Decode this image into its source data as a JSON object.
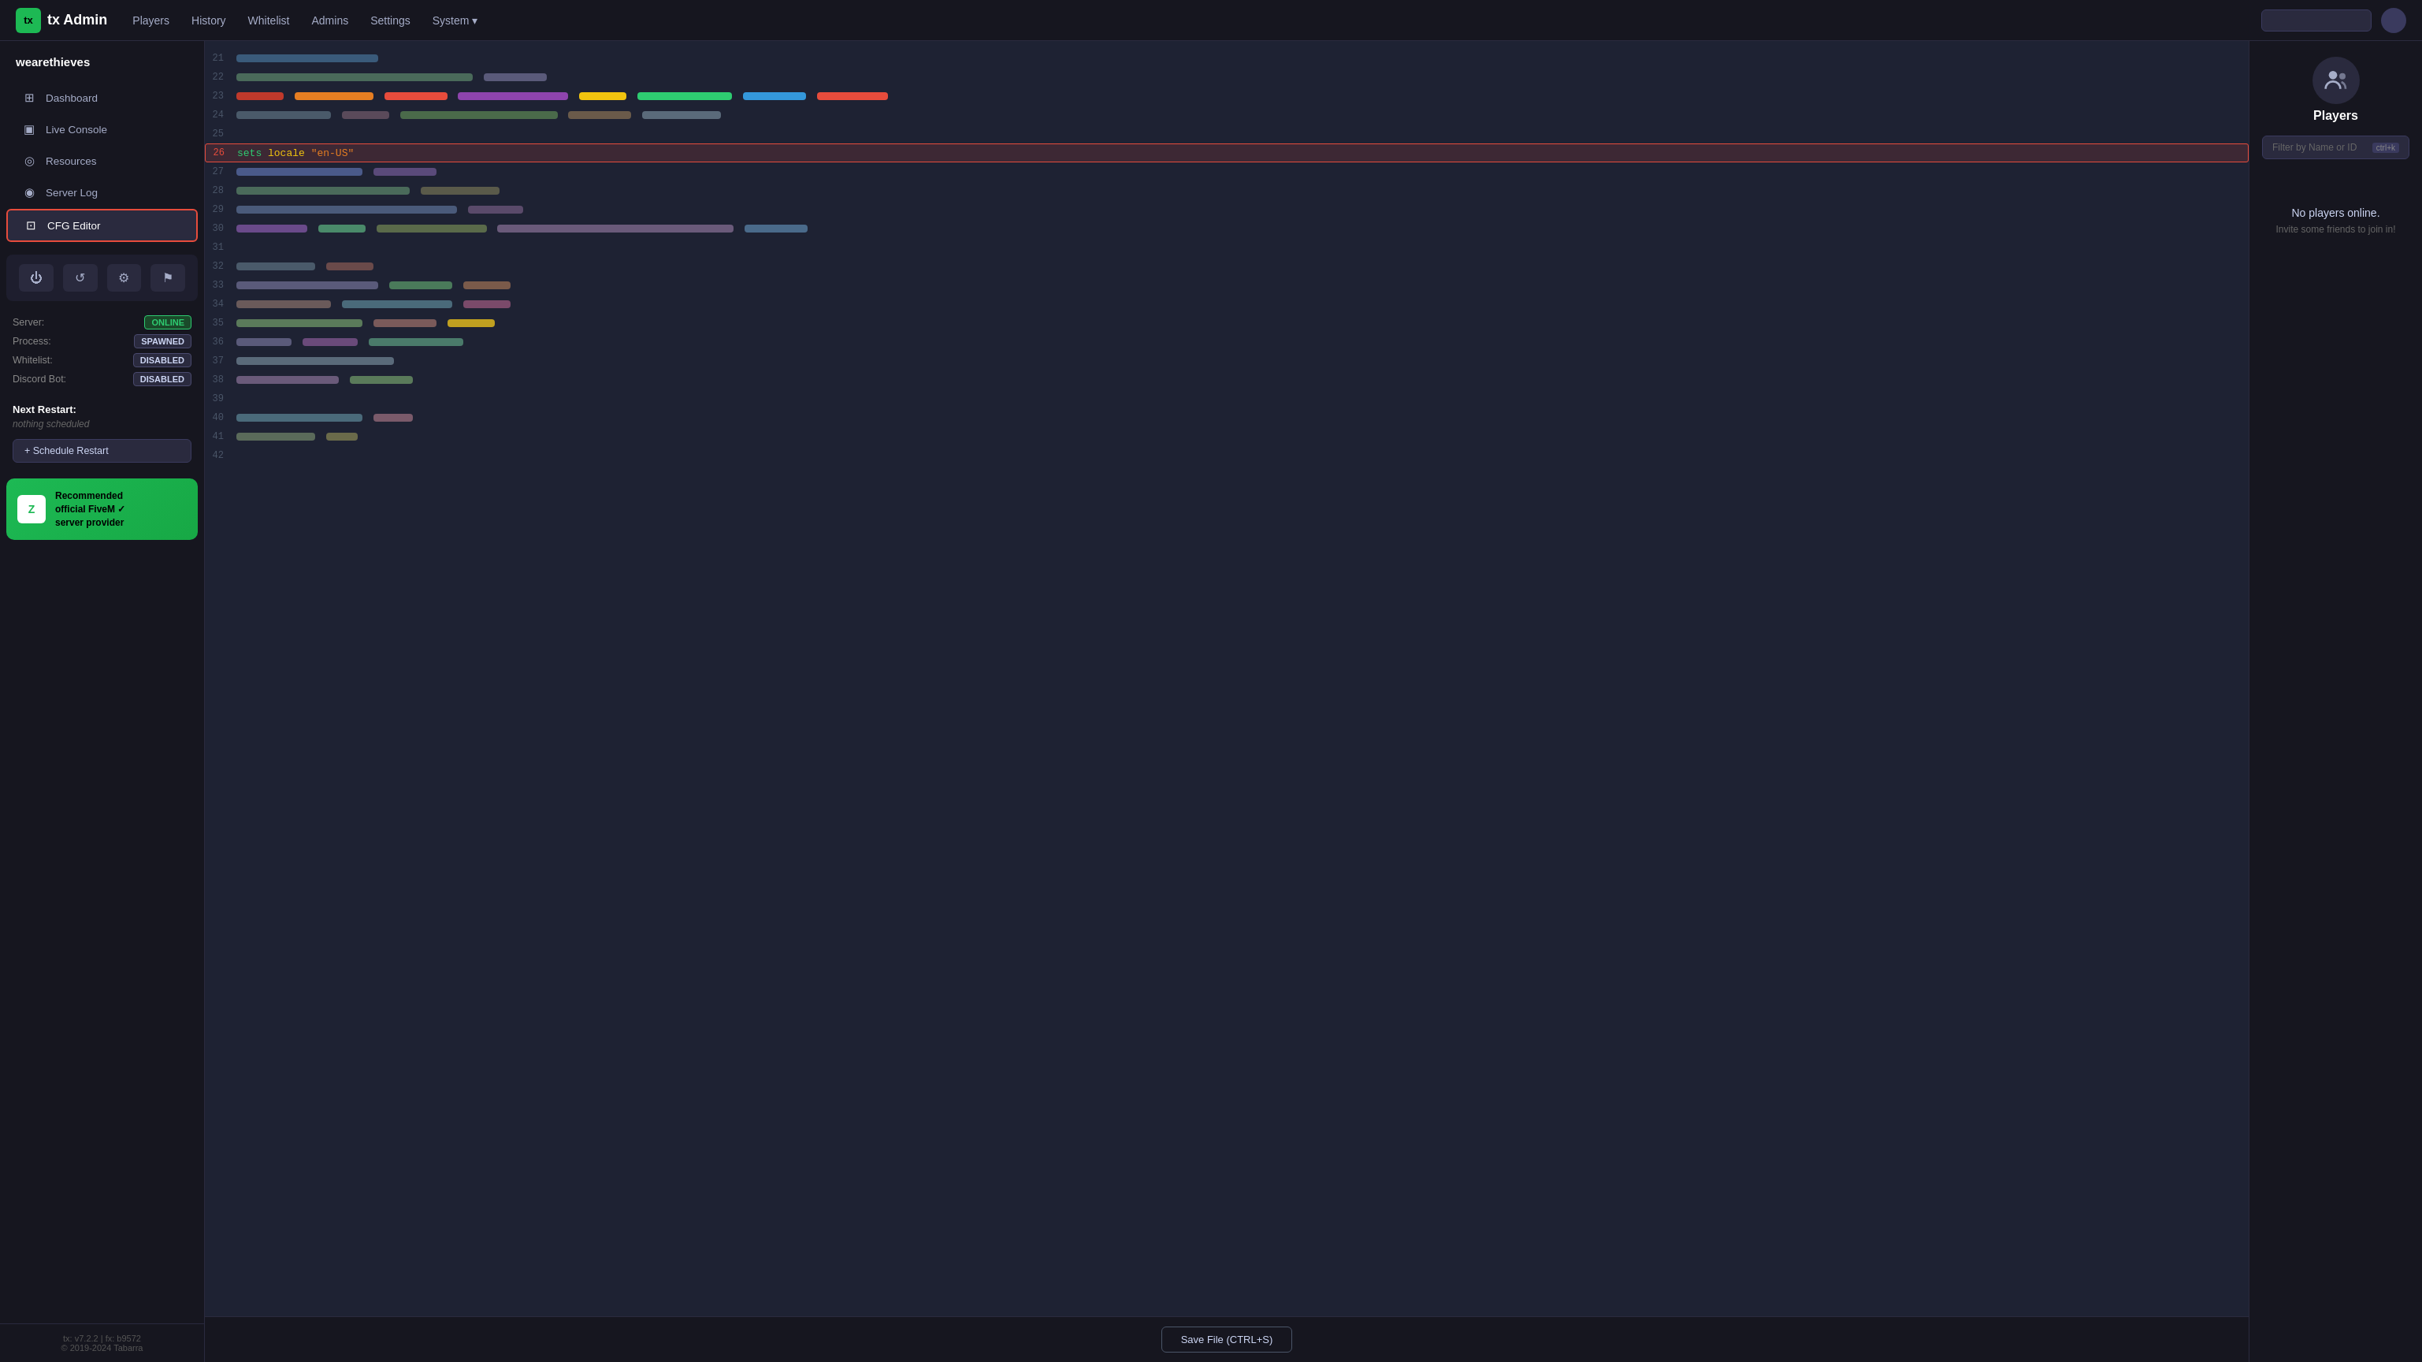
{
  "app": {
    "logo_text": "tx Admin",
    "logo_abbr": "tx"
  },
  "topnav": {
    "links": [
      {
        "label": "Players",
        "active": false
      },
      {
        "label": "History",
        "active": false
      },
      {
        "label": "Whitelist",
        "active": false
      },
      {
        "label": "Admins",
        "active": false
      },
      {
        "label": "Settings",
        "active": false
      },
      {
        "label": "System",
        "active": false,
        "has_dropdown": true
      }
    ]
  },
  "sidebar": {
    "brand": "wearethieves",
    "nav_items": [
      {
        "label": "Dashboard",
        "icon": "⊞",
        "active": false
      },
      {
        "label": "Live Console",
        "icon": "▣",
        "active": false
      },
      {
        "label": "Resources",
        "icon": "◎",
        "active": false
      },
      {
        "label": "Server Log",
        "icon": "◉",
        "active": false
      },
      {
        "label": "CFG Editor",
        "icon": "⊡",
        "active": true
      }
    ],
    "status": {
      "server_label": "Server:",
      "server_value": "ONLINE",
      "process_label": "Process:",
      "process_value": "SPAWNED",
      "whitelist_label": "Whitelist:",
      "whitelist_value": "DISABLED",
      "discord_label": "Discord Bot:",
      "discord_value": "DISABLED"
    },
    "next_restart": {
      "label": "Next Restart:",
      "value": "nothing scheduled"
    },
    "schedule_btn": "+ Schedule Restart",
    "zap": {
      "line1": "Recommended",
      "line2": "official FiveM ✓",
      "line3": "server provider"
    },
    "footer": {
      "version": "tx: v7.2.2 | fx: b9572",
      "copyright": "© 2019-2024 Tabarra"
    }
  },
  "cfg_editor": {
    "highlighted_line": 26,
    "highlighted_code": "sets locale \"en-US\"",
    "save_button": "Save File (CTRL+S)",
    "lines": [
      21,
      22,
      23,
      24,
      25,
      26,
      27,
      28,
      29,
      30,
      31,
      32,
      33,
      34,
      35,
      36,
      37,
      38,
      39,
      40,
      41,
      42
    ]
  },
  "players_panel": {
    "title": "Players",
    "search_placeholder": "Filter by Name or ID",
    "search_shortcut": "ctrl+k",
    "no_players_title": "No players online.",
    "no_players_sub": "Invite some friends to join in!"
  }
}
